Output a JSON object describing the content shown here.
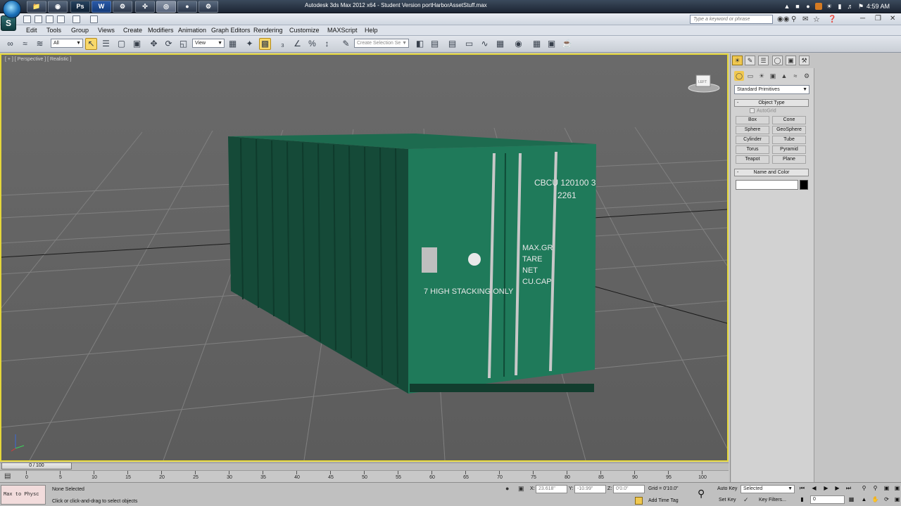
{
  "os": {
    "clock": "4:59 AM",
    "taskbar_apps": [
      "explorer",
      "chrome",
      "photoshop",
      "word",
      "steam-like",
      "3dsmax",
      "app7",
      "steam"
    ],
    "ps_label": "Ps",
    "word_label": "W"
  },
  "window": {
    "title": "Autodesk 3ds Max  2012 x64  -  Student Version    portHarborAssetStuff.max",
    "logo": "S",
    "search_placeholder": "Type a keyword or phrase"
  },
  "menu": [
    "Edit",
    "Tools",
    "Group",
    "Views",
    "Create",
    "Modifiers",
    "Animation",
    "Graph Editors",
    "Rendering",
    "Customize",
    "MAXScript",
    "Help"
  ],
  "toolbar": {
    "selection_filter": "All",
    "ref_coord": "View",
    "named_selection_placeholder": "Create Selection Se"
  },
  "viewport": {
    "label": "[ + ] [ Perspective ] [ Realistic ]",
    "container_text": {
      "code": "CBCU 120100 3",
      "code2": "2261",
      "maxgr": "MAX.GR",
      "tare": "TARE",
      "net": "NET",
      "cucap": "CU.CAP",
      "stack": "7 HIGH STACKING ONLY"
    },
    "viewcube_label": "LEFT"
  },
  "command_panel": {
    "dropdown": "Standard Primitives",
    "object_type_title": "Object Type",
    "autogrid": "AutoGrid",
    "primitives": [
      "Box",
      "Cone",
      "Sphere",
      "GeoSphere",
      "Cylinder",
      "Tube",
      "Torus",
      "Pyramid",
      "Teapot",
      "Plane"
    ],
    "name_color_title": "Name and Color",
    "minus": "-"
  },
  "timeline": {
    "frame": "0 / 100",
    "ticks": [
      "0",
      "5",
      "10",
      "15",
      "20",
      "25",
      "30",
      "35",
      "40",
      "45",
      "50",
      "55",
      "60",
      "65",
      "70",
      "75",
      "80",
      "85",
      "90",
      "95",
      "100"
    ]
  },
  "status": {
    "maxscript": "Max to Physc",
    "selection": "None Selected",
    "prompt": "Click or click-and-drag to select objects",
    "x_label": "X:",
    "x_value": "23.618\"",
    "y_label": "Y:",
    "y_value": "-10.99\"",
    "z_label": "Z:",
    "z_value": "0'0.0\"",
    "grid": "Grid = 0'10.0\"",
    "add_time_tag": "Add Time Tag",
    "auto_key": "Auto Key",
    "set_key": "Set Key",
    "key_selected": "Selected",
    "key_filters": "Key Filters...",
    "frame_field": "0"
  }
}
